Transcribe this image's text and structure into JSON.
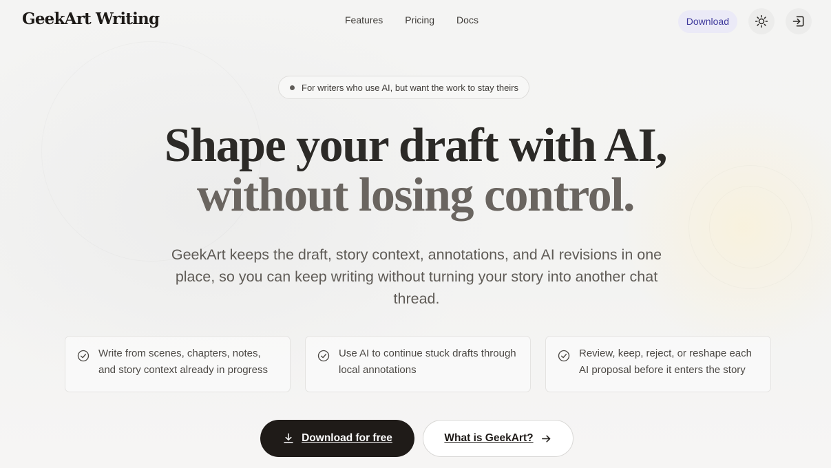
{
  "header": {
    "brand": "GeekArt Writing",
    "nav": [
      {
        "label": "Features"
      },
      {
        "label": "Pricing"
      },
      {
        "label": "Docs"
      }
    ],
    "download_label": "Download",
    "theme_toggle_icon": "sun-icon",
    "login_icon": "sign-in-icon"
  },
  "hero": {
    "badge": "For writers who use AI, but want the work to stay theirs",
    "headline_line1": "Shape your draft with AI,",
    "headline_line2": "without losing control.",
    "subtitle": "GeekArt keeps the draft, story context, annotations, and AI revisions in one place, so you can keep writing without turning your story into another chat thread."
  },
  "features": [
    {
      "icon": "check-circle-icon",
      "text": "Write from scenes, chapters, notes, and story context already in progress"
    },
    {
      "icon": "check-circle-icon",
      "text": "Use AI to continue stuck drafts through local annotations"
    },
    {
      "icon": "check-circle-icon",
      "text": "Review, keep, reject, or reshape each AI proposal before it enters the story"
    }
  ],
  "cta": {
    "primary_label": "Download for free",
    "primary_icon": "download-icon",
    "secondary_label": "What is GeekArt?",
    "secondary_icon": "arrow-right-icon"
  },
  "colors": {
    "accent_chip_bg": "#ebeaf7",
    "accent_chip_text": "#3f3a9c",
    "primary_button": "#1f1b18"
  }
}
